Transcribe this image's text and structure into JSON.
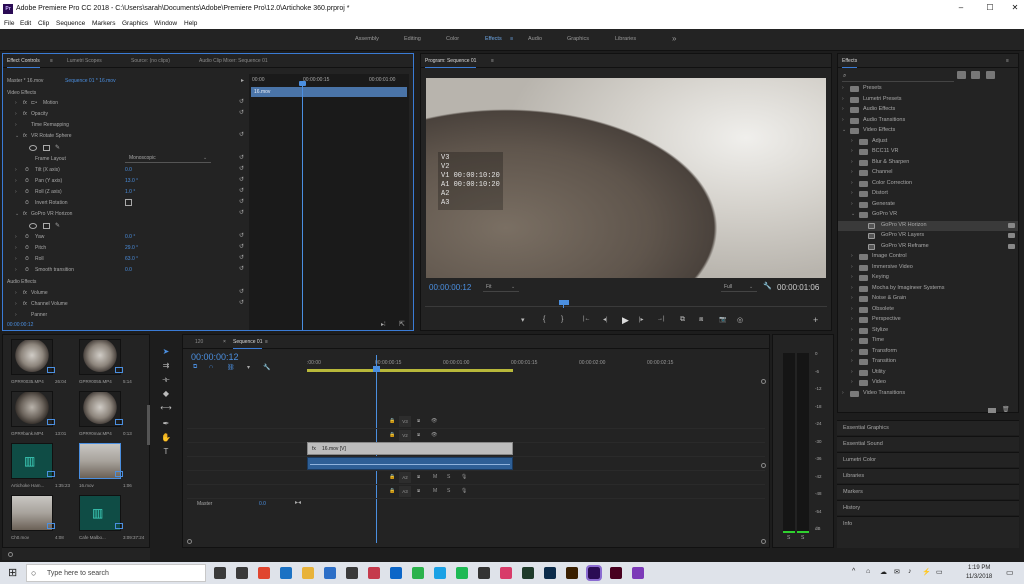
{
  "window": {
    "app_icon": "Pr",
    "title": "Adobe Premiere Pro CC 2018 - C:\\Users\\sarah\\Documents\\Adobe\\Premiere Pro\\12.0\\Artichoke 360.prproj *",
    "minimize": "‒",
    "maximize": "☐",
    "close": "✕"
  },
  "menu": [
    "File",
    "Edit",
    "Clip",
    "Sequence",
    "Markers",
    "Graphics",
    "Window",
    "Help"
  ],
  "workspaces": {
    "items": [
      "Assembly",
      "Editing",
      "Color",
      "Effects",
      "Audio",
      "Graphics",
      "Libraries"
    ],
    "active": "Effects",
    "more": "»"
  },
  "effect_controls": {
    "tabs": [
      "Effect Controls",
      "Lumetri Scopes",
      "Source: (no clips)",
      "Audio Clip Mixer: Sequence 01"
    ],
    "master_label": "Master * 16.mov",
    "master_clip": "Sequence 01 * 16.mov",
    "mini_ruler": [
      "00:00",
      "00:00:00:15",
      "00:00:01:00"
    ],
    "clip_bar": "16.mov",
    "section_video": "Video Effects",
    "rows": [
      {
        "name": "Motion",
        "fx": "fx"
      },
      {
        "name": "Opacity",
        "fx": "fx"
      },
      {
        "name": "Time Remapping",
        "fx": ""
      },
      {
        "name": "VR Rotate Sphere",
        "fx": "fx"
      },
      {
        "name": "Frame Layout",
        "value": "Monoscopic"
      },
      {
        "name": "Tilt (X axis)",
        "value": "0.0"
      },
      {
        "name": "Pan (Y axis)",
        "value": "13.0 °"
      },
      {
        "name": "Roll (Z axis)",
        "value": "1.0 °"
      },
      {
        "name": "Invert Rotation",
        "value": ""
      },
      {
        "name": "GoPro VR Horizon",
        "fx": "fx"
      },
      {
        "name": "Yaw",
        "value": "0.0 °"
      },
      {
        "name": "Pitch",
        "value": "29.0 °"
      },
      {
        "name": "Roll",
        "value": "63.0 °"
      },
      {
        "name": "Smooth transition",
        "value": "0.0"
      }
    ],
    "section_audio": "Audio Effects",
    "audio_rows": [
      {
        "name": "Volume",
        "fx": "fx"
      },
      {
        "name": "Channel Volume",
        "fx": "fx"
      },
      {
        "name": "Panner",
        "fx": ""
      }
    ],
    "footer_tc": "00:00:00:12"
  },
  "program": {
    "title": "Program: Sequence 01",
    "overlay_lines": [
      "V3",
      "V2",
      "V1  00:00:10:20",
      "A1  00:00:10:20",
      "A2",
      "A3"
    ],
    "timecode": "00:00:00:12",
    "fit": "Fit",
    "quality": "Full",
    "duration": "00:00:01:06",
    "controls": [
      "▾",
      "{",
      "}",
      "|←",
      "◂|",
      "▶",
      "|▸",
      "→|",
      "⧉",
      "⧈",
      "📷",
      "◎"
    ],
    "add": "+"
  },
  "project_bins": [
    {
      "name": "GPR#0035.MP4",
      "duration": "26:04",
      "kind": "sphere"
    },
    {
      "name": "GPR#0055.MP4",
      "duration": "5:14",
      "kind": "sphere"
    },
    {
      "name": "GPR#bank.MP4",
      "duration": "13:01",
      "kind": "sphere-dark"
    },
    {
      "name": "GPR#0mar.MP4",
      "duration": "0:13",
      "kind": "sphere"
    },
    {
      "name": "Artichoke Ham...",
      "duration": "1:35:23",
      "kind": "audio"
    },
    {
      "name": "16.mov",
      "duration": "1:06",
      "kind": "pano"
    },
    {
      "name": "Ch0.mov",
      "duration": "4:08",
      "kind": "pano"
    },
    {
      "name": "Cafe Malbo...",
      "duration": "3:09:37:24",
      "kind": "audio"
    }
  ],
  "timeline": {
    "tabs": [
      "120",
      "Sequence 01"
    ],
    "timecode": "00:00:00:12",
    "ruler": [
      ":00:00",
      "00:00:00:15",
      "00:00:01:00",
      "00:00:01:15",
      "00:00:02:00",
      "00:00:02:15"
    ],
    "tracks": [
      {
        "src": "",
        "name": "V3",
        "kind": "video"
      },
      {
        "src": "",
        "name": "V2",
        "kind": "video"
      },
      {
        "src": "V1",
        "name": "V1",
        "kind": "video"
      },
      {
        "src": "A1",
        "name": "A1",
        "kind": "audio"
      },
      {
        "src": "",
        "name": "A2",
        "kind": "audio"
      },
      {
        "src": "",
        "name": "A3",
        "kind": "audio"
      }
    ],
    "master": "Master",
    "master_val": "0.0",
    "clip_label": "16.mov [V]"
  },
  "audio_meter": {
    "scale": [
      "0",
      "-6",
      "-12",
      "-18",
      "-24",
      "-30",
      "-36",
      "-42",
      "-48",
      "-54",
      "dB"
    ],
    "buttons": [
      "S",
      "S"
    ]
  },
  "effects_panel": {
    "title": "Effects",
    "search_placeholder": "",
    "items": [
      {
        "name": "Presets",
        "depth": 0,
        "open": false
      },
      {
        "name": "Lumetri Presets",
        "depth": 0,
        "open": false
      },
      {
        "name": "Audio Effects",
        "depth": 0,
        "open": false
      },
      {
        "name": "Audio Transitions",
        "depth": 0,
        "open": false
      },
      {
        "name": "Video Effects",
        "depth": 0,
        "open": true
      },
      {
        "name": "Adjust",
        "depth": 1,
        "open": false
      },
      {
        "name": "BCC11 VR",
        "depth": 1,
        "open": false
      },
      {
        "name": "Blur & Sharpen",
        "depth": 1,
        "open": false
      },
      {
        "name": "Channel",
        "depth": 1,
        "open": false
      },
      {
        "name": "Color Correction",
        "depth": 1,
        "open": false
      },
      {
        "name": "Distort",
        "depth": 1,
        "open": false
      },
      {
        "name": "Generate",
        "depth": 1,
        "open": false
      },
      {
        "name": "GoPro VR",
        "depth": 1,
        "open": true
      },
      {
        "name": "GoPro VR Horizon",
        "depth": 2,
        "sel": true
      },
      {
        "name": "GoPro VR Layers",
        "depth": 2
      },
      {
        "name": "GoPro VR Reframe",
        "depth": 2
      },
      {
        "name": "Image Control",
        "depth": 1,
        "open": false
      },
      {
        "name": "Immersive Video",
        "depth": 1,
        "open": false
      },
      {
        "name": "Keying",
        "depth": 1,
        "open": false
      },
      {
        "name": "Mocha by Imagineer Systems",
        "depth": 1,
        "open": false
      },
      {
        "name": "Noise & Grain",
        "depth": 1,
        "open": false
      },
      {
        "name": "Obsolete",
        "depth": 1,
        "open": false
      },
      {
        "name": "Perspective",
        "depth": 1,
        "open": false
      },
      {
        "name": "Stylize",
        "depth": 1,
        "open": false
      },
      {
        "name": "Time",
        "depth": 1,
        "open": false
      },
      {
        "name": "Transform",
        "depth": 1,
        "open": false
      },
      {
        "name": "Transition",
        "depth": 1,
        "open": false
      },
      {
        "name": "Utility",
        "depth": 1,
        "open": false
      },
      {
        "name": "Video",
        "depth": 1,
        "open": false
      },
      {
        "name": "Video Transitions",
        "depth": 0,
        "open": false
      }
    ],
    "collapsed_panels": [
      "Essential Graphics",
      "Essential Sound",
      "Lumetri Color",
      "Libraries",
      "Markers",
      "History",
      "Info"
    ]
  },
  "taskbar": {
    "search_placeholder": "Type here to search",
    "time": "1:19 PM",
    "date": "11/3/2018",
    "icons": [
      {
        "name": "mic",
        "color": "#3a3a3a"
      },
      {
        "name": "task-view",
        "color": "#3a3a3a"
      },
      {
        "name": "chrome",
        "color": "#e0452f"
      },
      {
        "name": "edge",
        "color": "#1b72c4"
      },
      {
        "name": "explorer",
        "color": "#e8b33a"
      },
      {
        "name": "mail",
        "color": "#2d6fc7"
      },
      {
        "name": "store",
        "color": "#3a3a3a"
      },
      {
        "name": "app-red",
        "color": "#c53a4c"
      },
      {
        "name": "trello",
        "color": "#0c66c8"
      },
      {
        "name": "feedly",
        "color": "#2bb24c"
      },
      {
        "name": "skype",
        "color": "#1aa1e5"
      },
      {
        "name": "spotify",
        "color": "#1db954"
      },
      {
        "name": "app-dark",
        "color": "#333333"
      },
      {
        "name": "itunes",
        "color": "#d83c6a"
      },
      {
        "name": "media-encoder",
        "color": "#1f3b2b"
      },
      {
        "name": "photoshop",
        "color": "#0b2b4a"
      },
      {
        "name": "illustrator",
        "color": "#3a1f00"
      },
      {
        "name": "premiere",
        "color": "#2a0b54"
      },
      {
        "name": "indesign",
        "color": "#48001f"
      },
      {
        "name": "misc",
        "color": "#7c3ab8"
      }
    ],
    "tray": [
      "^",
      "⌂",
      "☁",
      "✉",
      "♪",
      "⚡",
      "▭"
    ]
  },
  "colors": {
    "accent": "#3a7bd5",
    "playhead": "#4b8fe0",
    "track_blue": "#1f4f85",
    "clip_video": "#bdbdbd",
    "clip_audio": "#2e5f96",
    "work_area": "#b8b83a"
  }
}
